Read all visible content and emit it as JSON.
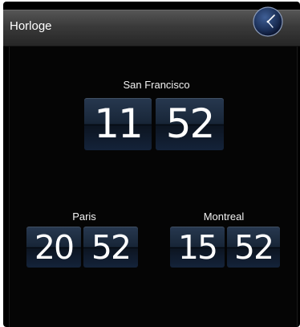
{
  "window": {
    "title": "Horloge",
    "icon": "clock-icon"
  },
  "clocks": [
    {
      "city": "San Francisco",
      "hours": "11",
      "minutes": "52"
    },
    {
      "city": "Paris",
      "hours": "20",
      "minutes": "52"
    },
    {
      "city": "Montreal",
      "hours": "15",
      "minutes": "52"
    }
  ],
  "colors": {
    "tile_top": "#27384f",
    "tile_bottom": "#14233a",
    "background": "#000000",
    "text": "#ffffff"
  }
}
